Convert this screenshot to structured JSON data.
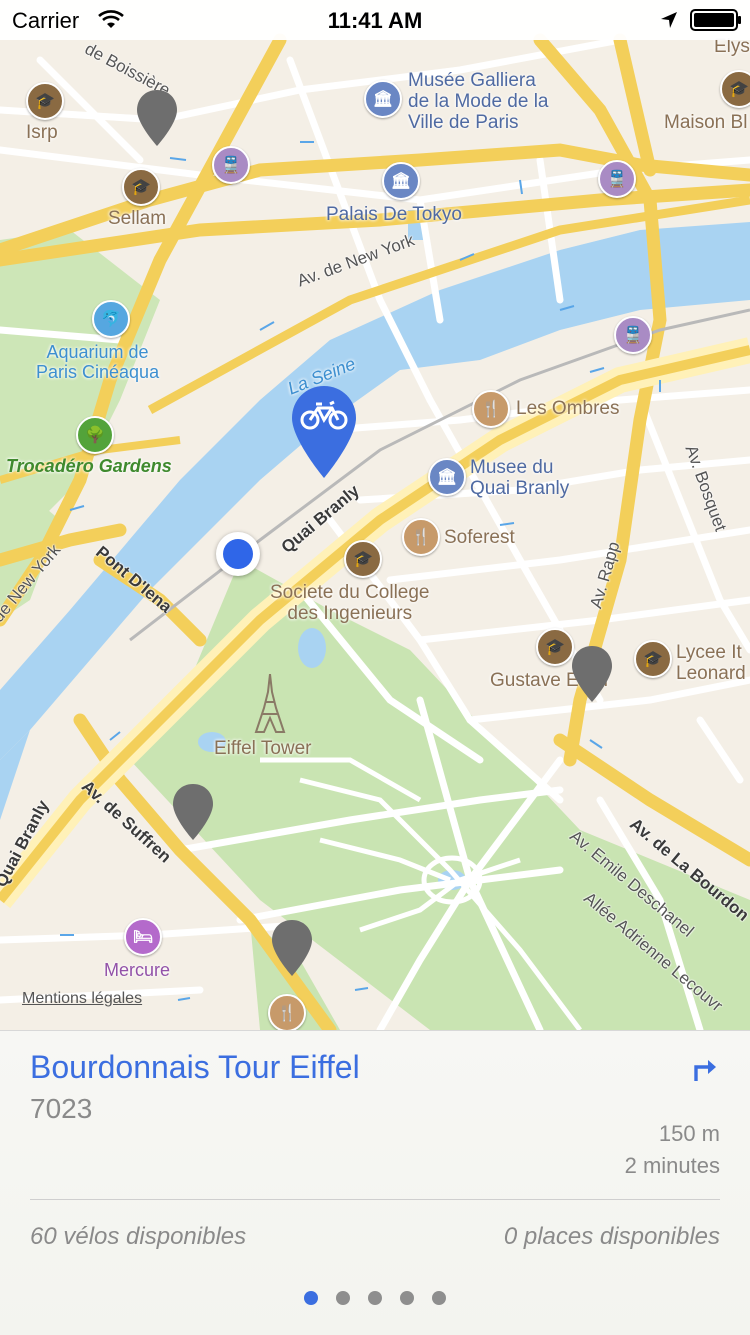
{
  "status_bar": {
    "carrier": "Carrier",
    "time": "11:41 AM"
  },
  "map": {
    "pois": {
      "isrp": "Isrp",
      "sellam": "Sellam",
      "galliera": "Musée Galliera\nde la Mode de la\nVille de Paris",
      "palais": "Palais De Tokyo",
      "maison": "Maison Bl",
      "elys": "Elys",
      "aquarium": "Aquarium de\nParis Cinéaqua",
      "trocadero": "Trocadéro Gardens",
      "les_ombres": "Les Ombres",
      "quai_branly_museum": "Musee du\nQuai Branly",
      "soferest": "Soferest",
      "societe": "Societe du College\ndes Ingenieurs",
      "gustave": "Gustave Eiffel",
      "lycee": "Lycee It\nLeonard",
      "eiffel": "Eiffel Tower",
      "mercure": "Mercure",
      "la_seine": "La Seine"
    },
    "streets": {
      "new_york_top": "Av. de New York",
      "new_york_left": "de New York",
      "quai_branly_mid": "Quai Branly",
      "quai_branly_left": "Quai Branly",
      "pont_diena": "Pont D'Iena",
      "av_suffren": "Av. de Suffren",
      "av_rapp": "Av. Rapp",
      "av_bosquet": "Av. Bosquet",
      "av_bourdonnais": "Av. de La Bourdon",
      "av_emile": "Av. Emile Deschanel",
      "allee_adrienne": "Allée Adrienne Lecouvr",
      "boissiere": "de Boissière"
    },
    "legal_link": "Mentions légales",
    "icons": {
      "education": "graduation-cap-icon",
      "restaurant": "fork-knife-icon",
      "museum": "museum-icon",
      "transit": "train-icon",
      "bicycle": "bicycle-icon",
      "park": "tree-icon",
      "aquarium": "dolphin-icon",
      "hotel": "bed-icon",
      "landmark": "eiffel-tower-icon",
      "pin": "map-pin-icon"
    },
    "colors": {
      "selected_pin": "#3b6ee0",
      "station_pin": "#6e6e6e",
      "user_location": "#2f66e8"
    }
  },
  "station": {
    "name": "Bourdonnais Tour Eiffel",
    "number": "7023",
    "distance": "150 m",
    "duration": "2 minutes",
    "bikes_available": "60 vélos disponibles",
    "places_available": "0 places disponibles",
    "directions_icon": "turn-right-arrow-icon"
  },
  "pager": {
    "count": 5,
    "active_index": 0
  }
}
